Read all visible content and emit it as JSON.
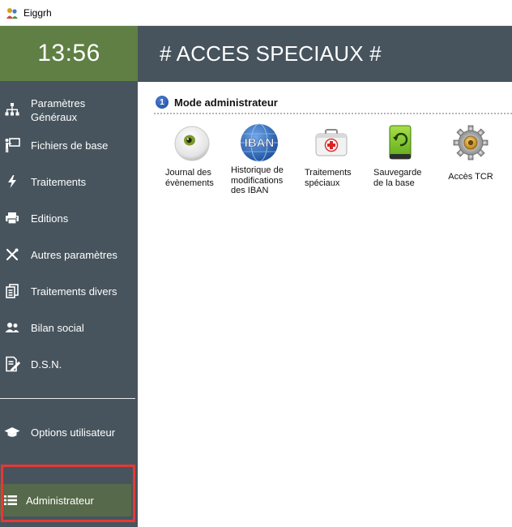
{
  "window": {
    "title": "Eiggrh"
  },
  "sidebar": {
    "clock": "13:56",
    "items": [
      {
        "label": "Paramètres Généraux",
        "icon": "org-chart-icon"
      },
      {
        "label": "Fichiers de base",
        "icon": "presenter-board-icon"
      },
      {
        "label": "Traitements",
        "icon": "lightning-icon"
      },
      {
        "label": "Editions",
        "icon": "printer-icon"
      },
      {
        "label": "Autres paramètres",
        "icon": "tools-icon"
      },
      {
        "label": "Traitements divers",
        "icon": "documents-icon"
      },
      {
        "label": "Bilan social",
        "icon": "users-icon"
      },
      {
        "label": "D.S.N.",
        "icon": "edit-document-icon"
      },
      {
        "label": "Options utilisateur",
        "icon": "graduation-cap-icon"
      }
    ],
    "admin": {
      "label": "Administrateur",
      "icon": "list-icon"
    }
  },
  "main": {
    "title": "# ACCES SPECIAUX #",
    "section": {
      "number": "1",
      "title": "Mode administrateur"
    },
    "tiles": [
      {
        "label": "Journal des évènements",
        "icon": "eye-icon"
      },
      {
        "label": "Historique de modifications des IBAN",
        "icon": "iban-globe-icon"
      },
      {
        "label": "Traitements spéciaux",
        "icon": "first-aid-kit-icon"
      },
      {
        "label": "Sauvegarde de la base",
        "icon": "backup-drive-icon"
      },
      {
        "label": "Accès TCR",
        "icon": "gear-icon"
      }
    ]
  },
  "colors": {
    "sidebar_bg": "#47545d",
    "clock_bg": "#5f7f44",
    "admin_bg": "#56694a",
    "highlight": "#e53935"
  }
}
